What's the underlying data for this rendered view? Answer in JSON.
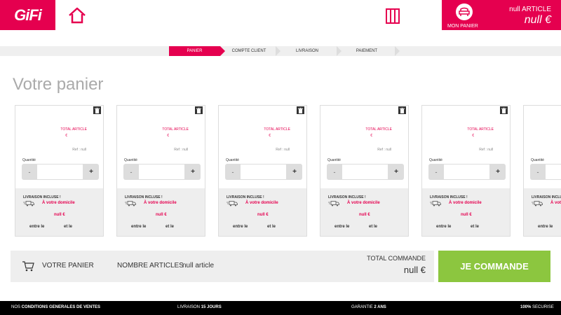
{
  "header": {
    "logo": "GiFi",
    "mon_panier": "MON PANIER",
    "null_article": "null ARTICLE",
    "null_euro": "null €"
  },
  "steps": [
    "PANIER",
    "COMPTE CLIENT",
    "LIVRAISON",
    "PAIEMENT"
  ],
  "page_title": "Votre panier",
  "card": {
    "total_article": "TOTAL ARTICLE",
    "euro": "€",
    "ref": "Ref : null",
    "quantite": "Quantité",
    "minus": "-",
    "plus": "+",
    "livraison_incluse": "LIVRAISON INCLUSE !",
    "domicile": "À votre domicile",
    "null_euro": "null €",
    "entre_le": "entre le",
    "et_le": "et le"
  },
  "summary": {
    "votre_panier": "VOTRE PANIER",
    "nombre_articles": "NOMBRE ARTICLES",
    "null_article": "null article",
    "total_commande": "TOTAL COMMANDE",
    "null_euro": "null €"
  },
  "commande_button": "JE COMMANDE",
  "footer": {
    "conditions_prefix": "NOS ",
    "conditions": "CONDITIONS GENERALES DE VENTES",
    "livraison_prefix": "LIVRAISON ",
    "livraison": "15 JOURS",
    "garantie_prefix": "GARANTIE ",
    "garantie": "2 ANS",
    "securise_prefix": "100%",
    "securise": " SECURISE"
  },
  "colors": {
    "brand": "#e5004f",
    "accent_green": "#8cc63f"
  },
  "icons": [
    "home-icon",
    "catalog-icon",
    "armchair-icon",
    "trash-icon",
    "truck-icon",
    "cart-icon"
  ]
}
